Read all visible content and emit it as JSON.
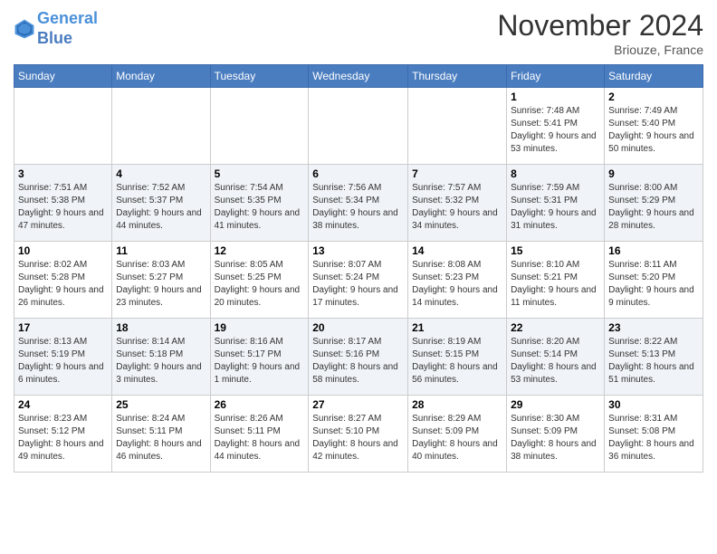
{
  "header": {
    "logo_line1": "General",
    "logo_line2": "Blue",
    "month_title": "November 2024",
    "location": "Briouze, France"
  },
  "weekdays": [
    "Sunday",
    "Monday",
    "Tuesday",
    "Wednesday",
    "Thursday",
    "Friday",
    "Saturday"
  ],
  "weeks": [
    [
      {
        "day": "",
        "info": ""
      },
      {
        "day": "",
        "info": ""
      },
      {
        "day": "",
        "info": ""
      },
      {
        "day": "",
        "info": ""
      },
      {
        "day": "",
        "info": ""
      },
      {
        "day": "1",
        "info": "Sunrise: 7:48 AM\nSunset: 5:41 PM\nDaylight: 9 hours and 53 minutes."
      },
      {
        "day": "2",
        "info": "Sunrise: 7:49 AM\nSunset: 5:40 PM\nDaylight: 9 hours and 50 minutes."
      }
    ],
    [
      {
        "day": "3",
        "info": "Sunrise: 7:51 AM\nSunset: 5:38 PM\nDaylight: 9 hours and 47 minutes."
      },
      {
        "day": "4",
        "info": "Sunrise: 7:52 AM\nSunset: 5:37 PM\nDaylight: 9 hours and 44 minutes."
      },
      {
        "day": "5",
        "info": "Sunrise: 7:54 AM\nSunset: 5:35 PM\nDaylight: 9 hours and 41 minutes."
      },
      {
        "day": "6",
        "info": "Sunrise: 7:56 AM\nSunset: 5:34 PM\nDaylight: 9 hours and 38 minutes."
      },
      {
        "day": "7",
        "info": "Sunrise: 7:57 AM\nSunset: 5:32 PM\nDaylight: 9 hours and 34 minutes."
      },
      {
        "day": "8",
        "info": "Sunrise: 7:59 AM\nSunset: 5:31 PM\nDaylight: 9 hours and 31 minutes."
      },
      {
        "day": "9",
        "info": "Sunrise: 8:00 AM\nSunset: 5:29 PM\nDaylight: 9 hours and 28 minutes."
      }
    ],
    [
      {
        "day": "10",
        "info": "Sunrise: 8:02 AM\nSunset: 5:28 PM\nDaylight: 9 hours and 26 minutes."
      },
      {
        "day": "11",
        "info": "Sunrise: 8:03 AM\nSunset: 5:27 PM\nDaylight: 9 hours and 23 minutes."
      },
      {
        "day": "12",
        "info": "Sunrise: 8:05 AM\nSunset: 5:25 PM\nDaylight: 9 hours and 20 minutes."
      },
      {
        "day": "13",
        "info": "Sunrise: 8:07 AM\nSunset: 5:24 PM\nDaylight: 9 hours and 17 minutes."
      },
      {
        "day": "14",
        "info": "Sunrise: 8:08 AM\nSunset: 5:23 PM\nDaylight: 9 hours and 14 minutes."
      },
      {
        "day": "15",
        "info": "Sunrise: 8:10 AM\nSunset: 5:21 PM\nDaylight: 9 hours and 11 minutes."
      },
      {
        "day": "16",
        "info": "Sunrise: 8:11 AM\nSunset: 5:20 PM\nDaylight: 9 hours and 9 minutes."
      }
    ],
    [
      {
        "day": "17",
        "info": "Sunrise: 8:13 AM\nSunset: 5:19 PM\nDaylight: 9 hours and 6 minutes."
      },
      {
        "day": "18",
        "info": "Sunrise: 8:14 AM\nSunset: 5:18 PM\nDaylight: 9 hours and 3 minutes."
      },
      {
        "day": "19",
        "info": "Sunrise: 8:16 AM\nSunset: 5:17 PM\nDaylight: 9 hours and 1 minute."
      },
      {
        "day": "20",
        "info": "Sunrise: 8:17 AM\nSunset: 5:16 PM\nDaylight: 8 hours and 58 minutes."
      },
      {
        "day": "21",
        "info": "Sunrise: 8:19 AM\nSunset: 5:15 PM\nDaylight: 8 hours and 56 minutes."
      },
      {
        "day": "22",
        "info": "Sunrise: 8:20 AM\nSunset: 5:14 PM\nDaylight: 8 hours and 53 minutes."
      },
      {
        "day": "23",
        "info": "Sunrise: 8:22 AM\nSunset: 5:13 PM\nDaylight: 8 hours and 51 minutes."
      }
    ],
    [
      {
        "day": "24",
        "info": "Sunrise: 8:23 AM\nSunset: 5:12 PM\nDaylight: 8 hours and 49 minutes."
      },
      {
        "day": "25",
        "info": "Sunrise: 8:24 AM\nSunset: 5:11 PM\nDaylight: 8 hours and 46 minutes."
      },
      {
        "day": "26",
        "info": "Sunrise: 8:26 AM\nSunset: 5:11 PM\nDaylight: 8 hours and 44 minutes."
      },
      {
        "day": "27",
        "info": "Sunrise: 8:27 AM\nSunset: 5:10 PM\nDaylight: 8 hours and 42 minutes."
      },
      {
        "day": "28",
        "info": "Sunrise: 8:29 AM\nSunset: 5:09 PM\nDaylight: 8 hours and 40 minutes."
      },
      {
        "day": "29",
        "info": "Sunrise: 8:30 AM\nSunset: 5:09 PM\nDaylight: 8 hours and 38 minutes."
      },
      {
        "day": "30",
        "info": "Sunrise: 8:31 AM\nSunset: 5:08 PM\nDaylight: 8 hours and 36 minutes."
      }
    ]
  ]
}
